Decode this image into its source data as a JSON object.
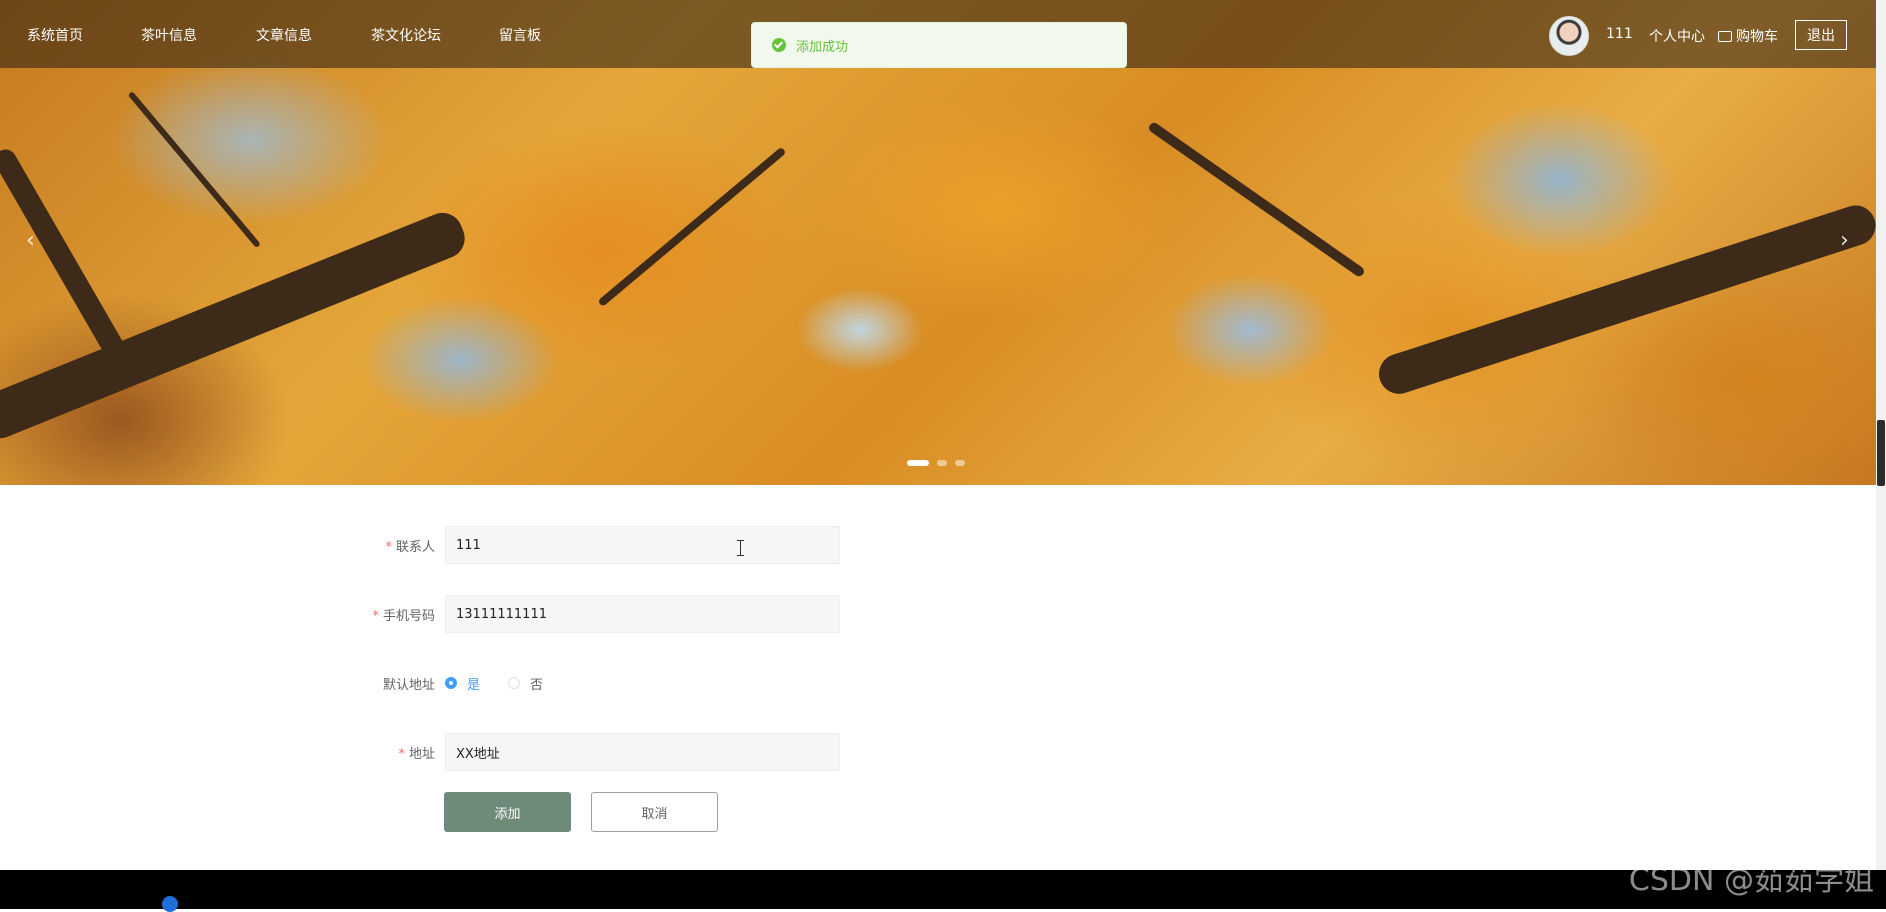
{
  "nav": {
    "items": [
      "系统首页",
      "茶叶信息",
      "文章信息",
      "茶文化论坛",
      "留言板"
    ],
    "user_name": "111",
    "personal_center": "个人中心",
    "cart": "购物车",
    "logout": "退出"
  },
  "toast": {
    "message": "添加成功",
    "type": "success"
  },
  "carousel": {
    "prev": "‹",
    "next": "›",
    "slide_count": 3,
    "active_slide": 1
  },
  "form": {
    "contact": {
      "label": "联系人",
      "required": "*",
      "value": "111"
    },
    "phone": {
      "label": "手机号码",
      "required": "*",
      "value": "13111111111"
    },
    "default_address": {
      "label": "默认地址",
      "options": [
        "是",
        "否"
      ],
      "selected": "是"
    },
    "address": {
      "label": "地址",
      "required": "*",
      "value": "XX地址"
    },
    "submit_label": "添加",
    "cancel_label": "取消"
  },
  "watermark": "CSDN @茹茹学姐",
  "colors": {
    "primary_button": "#6e8a78",
    "radio_accent": "#409eff",
    "toast_green": "#67c23a",
    "required": "#f56c6c"
  }
}
